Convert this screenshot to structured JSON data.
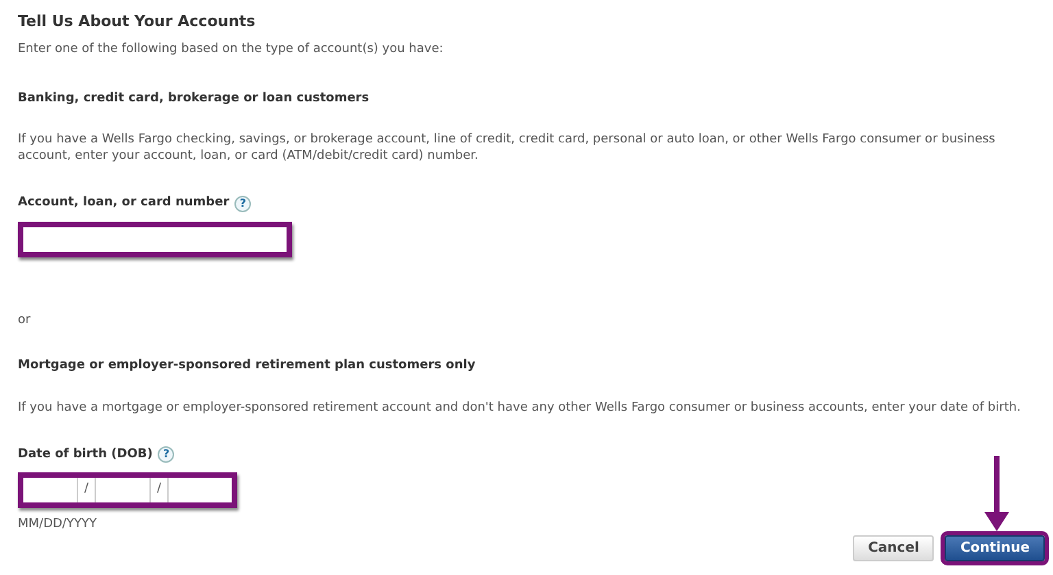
{
  "title": "Tell Us About Your Accounts",
  "intro": "Enter one of the following based on the type of account(s) you have:",
  "sections": [
    {
      "heading": "Banking, credit card, brokerage or loan customers",
      "text": "If you have a Wells Fargo checking, savings, or brokerage account, line of credit, credit card, personal or auto loan, or other Wells Fargo consumer or business account, enter your account, loan, or card (ATM/debit/credit card) number.",
      "label": "Account, loan, or card number",
      "help": "?",
      "kind": "text",
      "highlighted": true
    },
    {
      "separator": "or",
      "heading": "Mortgage or employer-sponsored retirement plan customers only",
      "text": "If you have a mortgage or employer-sponsored retirement account and don't have any other Wells Fargo consumer or business accounts, enter your date of birth.",
      "label": "Date of birth (DOB)",
      "help": "?",
      "kind": "date",
      "separators": [
        "/",
        "/"
      ],
      "hint": "MM/DD/YYYY",
      "highlighted": true
    }
  ],
  "buttons": [
    {
      "label": "Cancel",
      "kind": "secondary",
      "highlighted": false
    },
    {
      "label": "Continue",
      "kind": "primary",
      "highlighted": true
    }
  ],
  "annotation_arrow": true
}
